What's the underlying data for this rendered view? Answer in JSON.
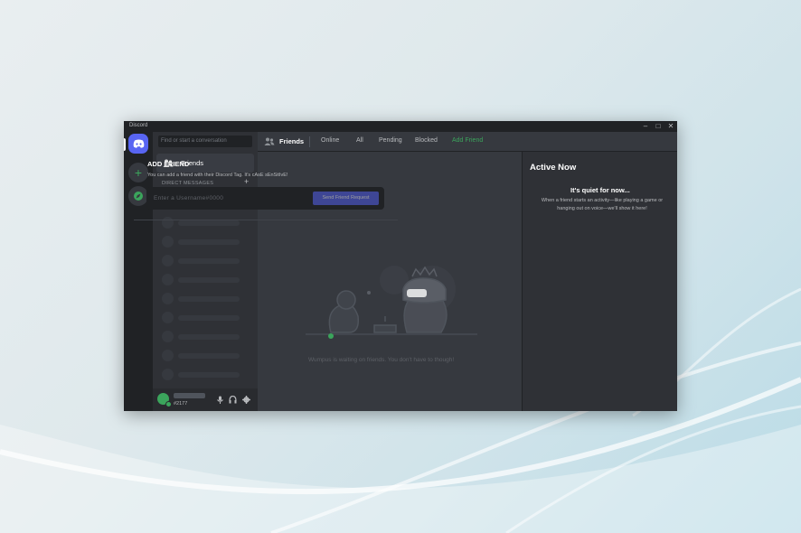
{
  "window": {
    "app_name": "Discord"
  },
  "sidebar": {
    "search_placeholder": "Find or start a conversation",
    "friends_label": "Friends",
    "dm_header": "DIRECT MESSAGES",
    "dm_add": "+"
  },
  "user": {
    "tag": "#2177"
  },
  "topbar": {
    "title": "Friends",
    "tabs": [
      "Online",
      "All",
      "Pending",
      "Blocked",
      "Add Friend"
    ]
  },
  "add_friend": {
    "title": "ADD FRIEND",
    "subtitle": "You can add a friend with their Discord Tag. It's cAsE sEnSitIvE!",
    "input_placeholder": "Enter a Username#0000",
    "button": "Send Friend Request"
  },
  "empty_state": {
    "text": "Wumpus is waiting on friends. You don't have to though!"
  },
  "active_now": {
    "title": "Active Now",
    "quiet_title": "It's quiet for now...",
    "quiet_desc": "When a friend starts an activity—like playing a game or hanging out on voice—we'll show it here!"
  },
  "colors": {
    "blurple": "#5865f2",
    "green": "#3ba55c",
    "bg_dark": "#202225",
    "bg_main": "#36393f"
  }
}
